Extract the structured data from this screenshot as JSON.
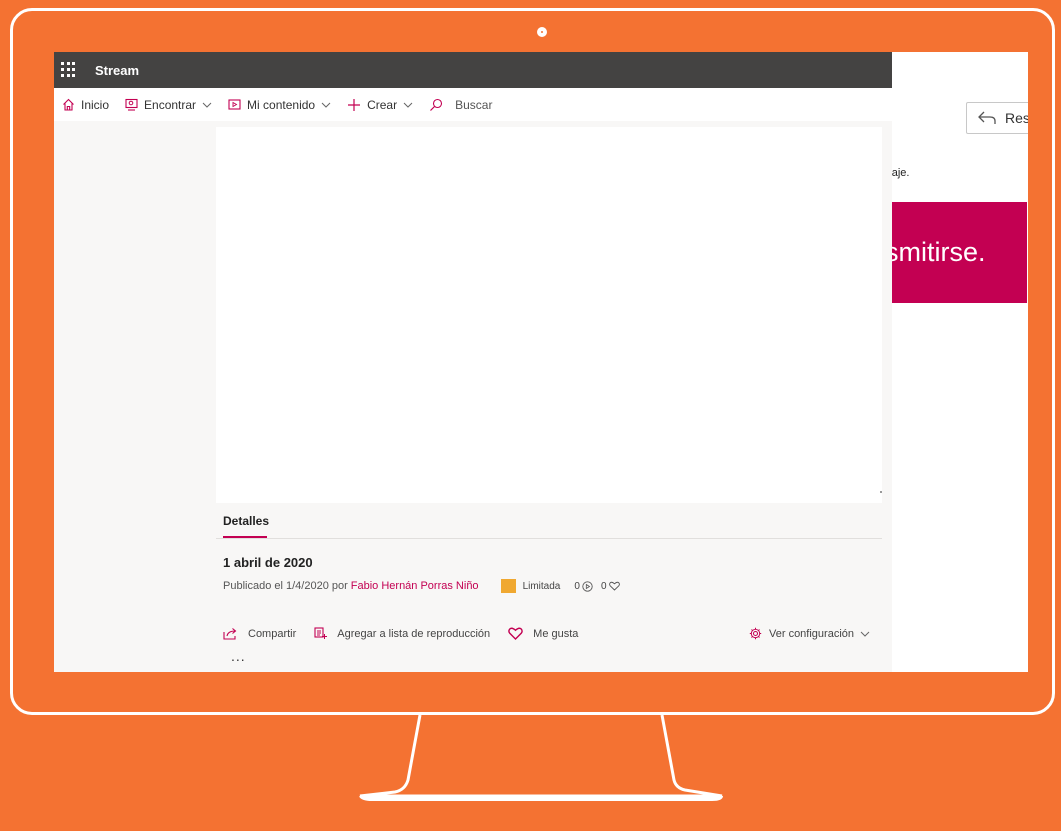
{
  "colors": {
    "background": "#F47232",
    "accent": "#C30052",
    "topbar": "#444342"
  },
  "app": {
    "name": "Stream"
  },
  "nav": {
    "home": "Inicio",
    "discover": "Encontrar",
    "my_content": "Mi contenido",
    "create": "Crear",
    "search_placeholder": "Buscar"
  },
  "details": {
    "tab_label": "Detalles",
    "title": "1 abril de 2020",
    "published_prefix": "Publicado el 1/4/2020 por",
    "author": "Fabio Hernán Porras Niño",
    "permission": "Limitada",
    "views": "0",
    "likes": "0"
  },
  "actions": {
    "share": "Compartir",
    "add_to_playlist": "Agregar a lista de reproducción",
    "like": "Me gusta",
    "settings": "Ver configuración",
    "more": "..."
  },
  "background_window": {
    "reply_label": "Res",
    "message_fragment": "ensaje.",
    "banner_text": "smitirse."
  },
  "icons": {
    "waffle": "app-launcher-icon",
    "home": "home-icon",
    "discover": "discover-icon",
    "my_content": "my-content-icon",
    "create": "plus-icon",
    "search": "search-icon",
    "views": "play-circle-icon",
    "likes": "heart-icon",
    "share": "share-icon",
    "playlist": "playlist-icon",
    "settings": "gear-icon",
    "reply": "reply-icon"
  }
}
